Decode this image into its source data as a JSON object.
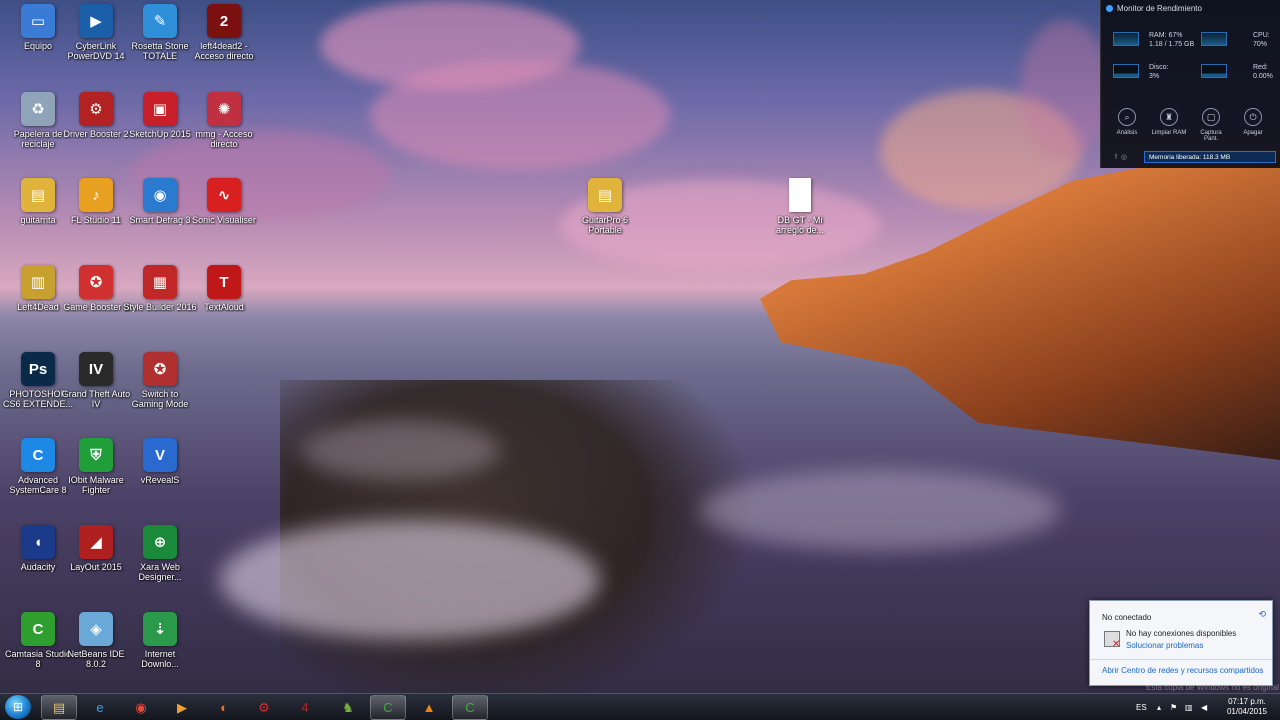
{
  "desktop": {
    "icons": [
      {
        "label": "Equipo",
        "icon": "computer-icon",
        "color": "#3a7bd5",
        "glyph": "▭"
      },
      {
        "label": "CyberLink\nPowerDVD 14",
        "icon": "powerdvd-icon",
        "color": "#1b5fa8",
        "glyph": "▶"
      },
      {
        "label": "Rosetta Stone\nTOTALE",
        "icon": "rosetta-stone-icon",
        "color": "#2f8fd8",
        "glyph": "✎"
      },
      {
        "label": "left4dead2 -\nAcceso directo",
        "icon": "left4dead2-icon",
        "color": "#7a1010",
        "glyph": "2"
      },
      {
        "label": "Papelera de\nreciclaje",
        "icon": "recycle-bin-icon",
        "color": "#8fa4b8",
        "glyph": "♻"
      },
      {
        "label": "Driver Booster 2",
        "icon": "driver-booster-icon",
        "color": "#b22222",
        "glyph": "⚙"
      },
      {
        "label": "SketchUp 2015",
        "icon": "sketchup-icon",
        "color": "#c8202a",
        "glyph": "▣"
      },
      {
        "label": "mmg - Acceso\ndirecto",
        "icon": "mmg-icon",
        "color": "#c03040",
        "glyph": "✺"
      },
      {
        "label": "guitarrita",
        "icon": "folder-icon",
        "color": "#e0b43a",
        "glyph": "▤"
      },
      {
        "label": "FL Studio 11",
        "icon": "fl-studio-icon",
        "color": "#e8a020",
        "glyph": "♪"
      },
      {
        "label": "Smart Defrag 3",
        "icon": "smart-defrag-icon",
        "color": "#2a7ad0",
        "glyph": "◉"
      },
      {
        "label": "Sonic Visualiser",
        "icon": "sonic-visualiser-icon",
        "color": "#d82020",
        "glyph": "∿"
      },
      {
        "label": "Left4Dead",
        "icon": "winrar-icon",
        "color": "#c8a030",
        "glyph": "▥"
      },
      {
        "label": "Game Booster 3",
        "icon": "game-booster-icon",
        "color": "#d03030",
        "glyph": "✪"
      },
      {
        "label": "Style Builder 2016",
        "icon": "style-builder-icon",
        "color": "#c02828",
        "glyph": "▦"
      },
      {
        "label": "TextAloud",
        "icon": "textaloud-icon",
        "color": "#c01818",
        "glyph": "T"
      },
      {
        "label": "PHOTOSHOP\nCS6 EXTENDE...",
        "icon": "photoshop-icon",
        "color": "#0a2a4a",
        "glyph": "Ps"
      },
      {
        "label": "Grand Theft Auto\nIV",
        "icon": "gta-iv-icon",
        "color": "#2a2a2a",
        "glyph": "IV"
      },
      {
        "label": "Switch to\nGaming Mode",
        "icon": "gaming-mode-icon",
        "color": "#b03030",
        "glyph": "✪"
      },
      {
        "label": "Advanced\nSystemCare 8",
        "icon": "advanced-systemcare-icon",
        "color": "#1e88e5",
        "glyph": "C"
      },
      {
        "label": "IObit Malware\nFighter",
        "icon": "iobit-malware-icon",
        "color": "#1f9e3a",
        "glyph": "⛨"
      },
      {
        "label": "vRevealS",
        "icon": "vreveal-icon",
        "color": "#2a6ad0",
        "glyph": "V"
      },
      {
        "label": "Audacity",
        "icon": "audacity-icon",
        "color": "#1b3a8a",
        "glyph": "◖"
      },
      {
        "label": "LayOut 2015",
        "icon": "layout-icon",
        "color": "#b02020",
        "glyph": "◢"
      },
      {
        "label": "Xara Web\nDesigner...",
        "icon": "xara-icon",
        "color": "#1a8a3a",
        "glyph": "⊕"
      },
      {
        "label": "Camtasia Studio\n8",
        "icon": "camtasia-icon",
        "color": "#2e9e2e",
        "glyph": "C"
      },
      {
        "label": "NetBeans IDE\n8.0.2",
        "icon": "netbeans-icon",
        "color": "#6aa8d8",
        "glyph": "◈"
      },
      {
        "label": "Internet\nDownlo...",
        "icon": "internet-download-icon",
        "color": "#2a9a4a",
        "glyph": "⇣"
      },
      {
        "label": "GuitarPro 6\nPortable",
        "icon": "folder-icon",
        "color": "#e0b43a",
        "glyph": "▤"
      },
      {
        "label": "DB GT - Mi\narreglo de...",
        "icon": "document-icon",
        "color": "#ffffff",
        "glyph": ""
      }
    ]
  },
  "gadget": {
    "title": "Monitor de Rendimiento",
    "ram": "RAM: 67%",
    "ram_detail": "1.18 / 1.75 GB",
    "cpu_label": "CPU:",
    "cpu_value": "70%",
    "disk_label": "Disco:",
    "disk_value": "3%",
    "net_label": "Red:",
    "net_value": "0.00%",
    "actions": [
      {
        "label": "Análisis",
        "glyph": "⌕"
      },
      {
        "label": "Limpiar RAM",
        "glyph": "♜"
      },
      {
        "label": "Captura\nPant.",
        "glyph": "▢"
      },
      {
        "label": "Apagar",
        "glyph": "⏻"
      }
    ],
    "memory_freed": "Memoria liberada: 118.3 MB"
  },
  "network_popup": {
    "title": "No conectado",
    "message": "No hay conexiones disponibles",
    "troubleshoot": "Solucionar problemas",
    "footer_link": "Abrir Centro de redes y recursos compartidos"
  },
  "watermark": "Esta copia de Windows no es original",
  "taskbar": {
    "pinned": [
      {
        "name": "explorer-icon",
        "glyph": "▤",
        "color": "#e8c060"
      },
      {
        "name": "internet-explorer-icon",
        "glyph": "e",
        "color": "#3aa0e8"
      },
      {
        "name": "chrome-icon",
        "glyph": "◉",
        "color": "#e84a3a"
      },
      {
        "name": "media-player-icon",
        "glyph": "▶",
        "color": "#f0a030"
      },
      {
        "name": "firefox-icon",
        "glyph": "◐",
        "color": "#f07020"
      },
      {
        "name": "settings-app-icon",
        "glyph": "⚙",
        "color": "#d03030"
      },
      {
        "name": "left4dead2-taskbar-icon",
        "glyph": "4",
        "color": "#c02020"
      },
      {
        "name": "game-taskbar-icon",
        "glyph": "♞",
        "color": "#7ab040"
      },
      {
        "name": "camtasia-recorder-icon",
        "glyph": "C",
        "color": "#3ab03a"
      },
      {
        "name": "vlc-icon",
        "glyph": "▲",
        "color": "#f08010"
      },
      {
        "name": "camtasia-studio-icon",
        "glyph": "C",
        "color": "#3ab03a"
      }
    ],
    "language": "ES",
    "time": "07:17 p.m.",
    "date": "01/04/2015"
  }
}
